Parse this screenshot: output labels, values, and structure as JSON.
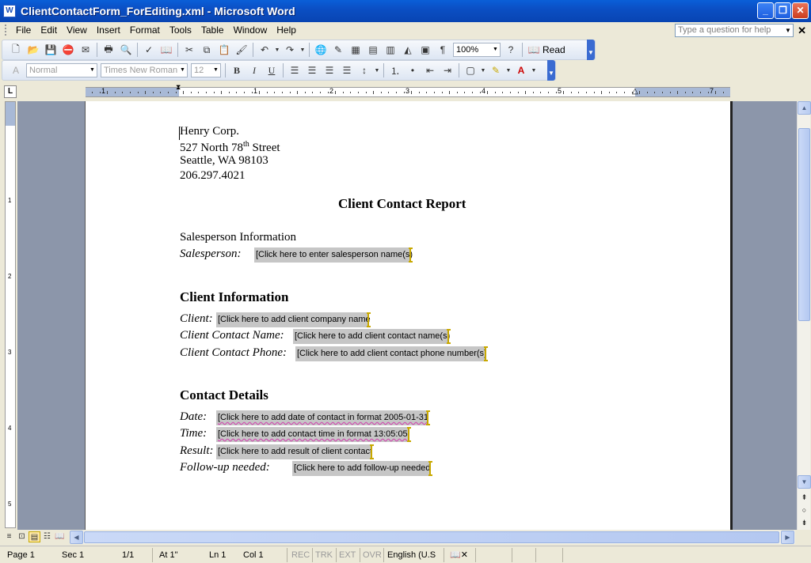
{
  "window": {
    "title": "ClientContactForm_ForEditing.xml - Microsoft Word",
    "app_icon_letter": "W",
    "minimize_glyph": "_",
    "maximize_glyph": "❐",
    "close_glyph": "✕"
  },
  "menu": {
    "items": [
      "File",
      "Edit",
      "View",
      "Insert",
      "Format",
      "Tools",
      "Table",
      "Window",
      "Help"
    ],
    "help_placeholder": "Type a question for help",
    "doc_close_glyph": "✕"
  },
  "standard_toolbar": {
    "zoom": "100%",
    "read_label": "Read"
  },
  "formatting_toolbar": {
    "style": "Normal",
    "font": "Times New Roman",
    "size": "12",
    "bold": "B",
    "italic": "I",
    "underline": "U"
  },
  "ruler": {
    "tab_glyph": "L",
    "h_numbers": [
      "1",
      "1",
      "2",
      "3",
      "4",
      "5",
      "7"
    ],
    "v_numbers": [
      "1",
      "2",
      "3",
      "4",
      "5"
    ]
  },
  "document": {
    "company": "Henry Corp.",
    "address_pre": "527 North 78",
    "address_sup": "th",
    "address_post": " Street",
    "city": "Seattle, WA  98103",
    "phone": "206.297.4021",
    "report_title": "Client Contact Report",
    "salesperson_section": "Salesperson Information",
    "salesperson_label": "Salesperson:",
    "salesperson_field": "[Click here to enter salesperson name(s)",
    "client_section": "Client Information",
    "client_label": "Client:",
    "client_field": "[Click here to add client company name",
    "contact_name_label": "Client Contact Name:",
    "contact_name_field": "[Click here to add client contact name(s)",
    "contact_phone_label": "Client Contact Phone:",
    "contact_phone_field": "[Click here to add client contact phone number(s)",
    "details_section": "Contact Details",
    "date_label": "Date:",
    "date_field": "[Click here to add date of contact in format 2005-01-31",
    "time_label": "Time:",
    "time_field": "[Click here to add contact time in format 13:05:05",
    "result_label": "Result:",
    "result_field": "[Click here to add result of client contact",
    "followup_label": "Follow-up needed:",
    "followup_field": "[Click here to add follow-up needed"
  },
  "statusbar": {
    "page": "Page  1",
    "sec": "Sec  1",
    "pages": "1/1",
    "at": "At  1\"",
    "ln": "Ln  1",
    "col": "Col  1",
    "rec": "REC",
    "trk": "TRK",
    "ext": "EXT",
    "ovr": "OVR",
    "language": "English (U.S"
  }
}
